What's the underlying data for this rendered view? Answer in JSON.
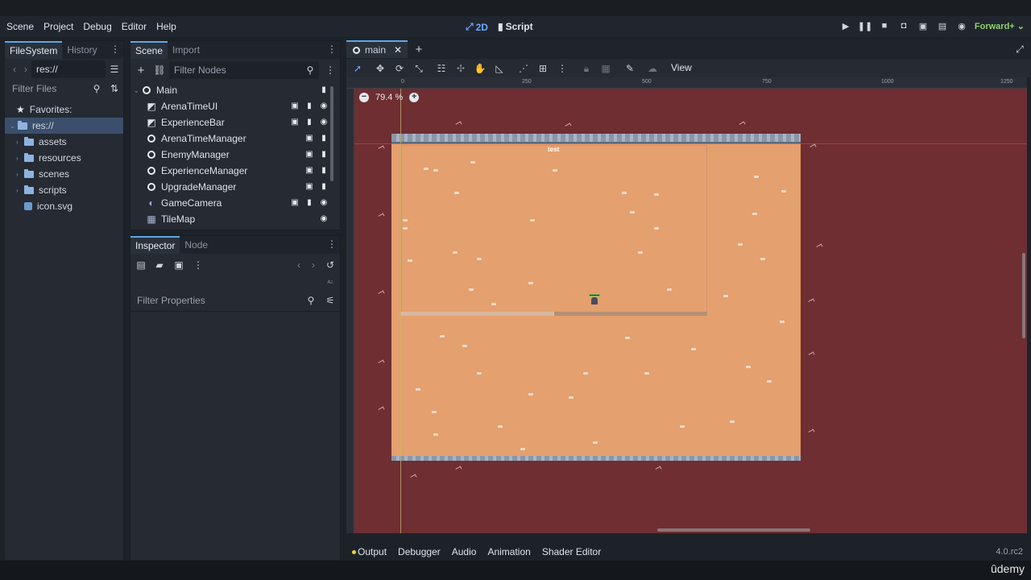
{
  "menu": [
    "Scene",
    "Project",
    "Debug",
    "Editor",
    "Help"
  ],
  "modes": {
    "twod": "2D",
    "script": "Script"
  },
  "renderer": "Forward+",
  "left_dock": {
    "tabs": [
      "FileSystem",
      "History"
    ],
    "path": "res://",
    "filter_placeholder": "Filter Files",
    "favorites": "Favorites:",
    "root": "res://",
    "items": [
      "assets",
      "resources",
      "scenes",
      "scripts",
      "icon.svg"
    ]
  },
  "scene_dock": {
    "tabs": [
      "Scene",
      "Import"
    ],
    "filter_placeholder": "Filter Nodes",
    "nodes": [
      "Main",
      "ArenaTimeUI",
      "ExperienceBar",
      "ArenaTimeManager",
      "EnemyManager",
      "ExperienceManager",
      "UpgradeManager",
      "GameCamera",
      "TileMap"
    ]
  },
  "inspector": {
    "tabs": [
      "Inspector",
      "Node"
    ],
    "filter_placeholder": "Filter Properties"
  },
  "editor": {
    "tab": "main",
    "view_label": "View",
    "zoom": "79.4 %",
    "ruler_labels": [
      "0",
      "250",
      "500",
      "750",
      "1000",
      "1250"
    ],
    "canvas_text": "test"
  },
  "bottom_tabs": [
    "Output",
    "Debugger",
    "Audio",
    "Animation",
    "Shader Editor"
  ],
  "version": "4.0.rc2",
  "watermark": "ûdemy",
  "colors": {
    "accent": "#5fa6e8",
    "renderer": "#8ed16a",
    "viewport_bg": "#6e2e32",
    "arena": "#e4a06e"
  }
}
